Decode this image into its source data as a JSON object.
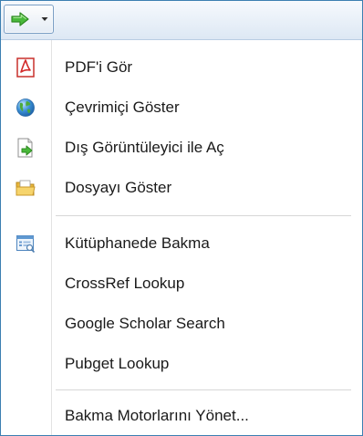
{
  "toolbar": {
    "button_icon": "green-arrow-icon",
    "dropdown_icon": "dropdown-arrow-icon"
  },
  "menu": {
    "items": [
      {
        "label": "PDF'i Gör",
        "icon": "pdf-icon"
      },
      {
        "label": "Çevrimiçi Göster",
        "icon": "globe-icon"
      },
      {
        "label": "Dış Görüntüleyici ile Aç",
        "icon": "open-external-icon"
      },
      {
        "label": "Dosyayı Göster",
        "icon": "folder-icon"
      },
      {
        "label": "Kütüphanede Bakma",
        "icon": "library-lookup-icon"
      },
      {
        "label": "CrossRef Lookup",
        "icon": ""
      },
      {
        "label": "Google Scholar Search",
        "icon": ""
      },
      {
        "label": "Pubget Lookup",
        "icon": ""
      },
      {
        "label": "Bakma Motorlarını Yönet...",
        "icon": ""
      }
    ]
  },
  "colors": {
    "frame_border": "#3c7fb1",
    "arrow_green": "#3aa02c",
    "pdf_red": "#d22a2a",
    "folder_yellow": "#f2c649"
  }
}
